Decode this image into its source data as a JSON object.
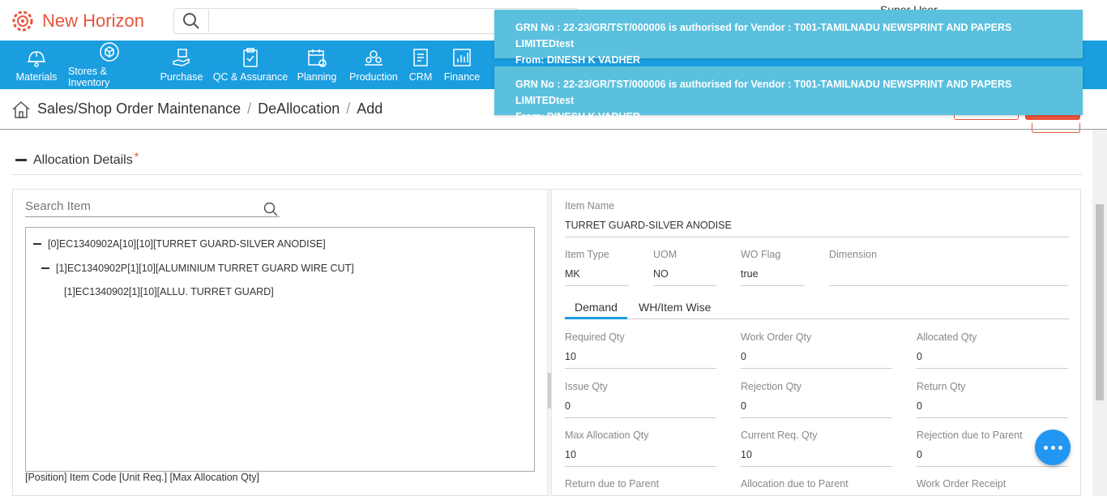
{
  "app": {
    "name": "New Horizon",
    "user": "Super User"
  },
  "nav": [
    {
      "label": "Materials",
      "icon": "helmet-icon"
    },
    {
      "label": "Stores & Inventory",
      "icon": "box-icon"
    },
    {
      "label": "Purchase",
      "icon": "hand-box-icon"
    },
    {
      "label": "QC & Assurance",
      "icon": "clipboard-check-icon"
    },
    {
      "label": "Planning",
      "icon": "calendar-icon"
    },
    {
      "label": "Production",
      "icon": "gears-icon"
    },
    {
      "label": "CRM",
      "icon": "document-icon"
    },
    {
      "label": "Finance",
      "icon": "chart-icon"
    }
  ],
  "breadcrumb": {
    "items": [
      "Sales/Shop Order Maintenance",
      "DeAllocation",
      "Add"
    ]
  },
  "section": {
    "title": "Allocation Details",
    "required_mark": "*"
  },
  "tree": {
    "search_placeholder": "Search Item",
    "nodes": [
      "[0]EC1340902A[10][10][TURRET GUARD-SILVER ANODISE]",
      "[1]EC1340902P[1][10][ALUMINIUM TURRET GUARD WIRE CUT]",
      "[1]EC1340902[1][10][ALLU. TURRET GUARD]"
    ],
    "legend": "[Position] Item Code [Unit Req.] [Max Allocation Qty]"
  },
  "details": {
    "item_name": {
      "label": "Item Name",
      "value": "TURRET GUARD-SILVER ANODISE"
    },
    "item_type": {
      "label": "Item Type",
      "value": "MK"
    },
    "uom": {
      "label": "UOM",
      "value": "NO"
    },
    "wo_flag": {
      "label": "WO Flag",
      "value": "true"
    },
    "dimension": {
      "label": "Dimension",
      "value": ""
    }
  },
  "tabs": [
    "Demand",
    "WH/Item Wise"
  ],
  "demand": {
    "required_qty": {
      "label": "Required Qty",
      "value": "10"
    },
    "work_order_qty": {
      "label": "Work Order Qty",
      "value": "0"
    },
    "allocated_qty": {
      "label": "Allocated Qty",
      "value": "0"
    },
    "issue_qty": {
      "label": "Issue Qty",
      "value": "0"
    },
    "rejection_qty": {
      "label": "Rejection Qty",
      "value": "0"
    },
    "return_qty": {
      "label": "Return Qty",
      "value": "0"
    },
    "max_allocation_qty": {
      "label": "Max Allocation Qty",
      "value": "10"
    },
    "current_req_qty": {
      "label": "Current Req. Qty",
      "value": "10"
    },
    "rejection_due_parent": {
      "label": "Rejection due to Parent",
      "value": "0"
    },
    "return_due_parent": {
      "label": "Return due to Parent"
    },
    "allocation_due_parent": {
      "label": "Allocation due to Parent"
    },
    "work_order_receipt": {
      "label": "Work Order Receipt"
    }
  },
  "toasts": [
    {
      "line1": "GRN No : 22-23/GR/TST/000006 is authorised for Vendor : T001-TAMILNADU NEWSPRINT AND PAPERS LIMITEDtest",
      "line2": "From: DINESH K VADHER"
    },
    {
      "line1": "GRN No : 22-23/GR/TST/000006 is authorised for Vendor : T001-TAMILNADU NEWSPRINT AND PAPERS LIMITEDtest",
      "line2": "From: DINESH K VADHER"
    }
  ],
  "colors": {
    "brand": "#e8553e",
    "nav": "#1a9ee0",
    "toast": "#5bc0de",
    "chat": "#2196f3"
  }
}
